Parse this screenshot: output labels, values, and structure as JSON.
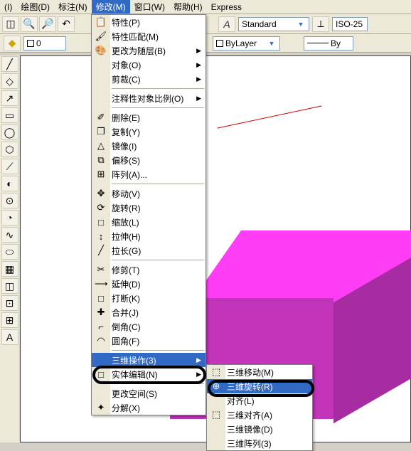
{
  "menubar": {
    "items": [
      "(I)",
      "绘图(D)",
      "标注(N)",
      "修改(M)",
      "窗口(W)",
      "帮助(H)",
      "Express"
    ],
    "activeIndex": 3
  },
  "toolbar1": {
    "standard": "Standard",
    "iso": "ISO-25"
  },
  "toolbar2": {
    "layer": "0",
    "bylayer": "ByLayer",
    "by2": "By"
  },
  "menu": [
    {
      "icon": "📋",
      "label": "特性(P)"
    },
    {
      "icon": "🖌",
      "label": "特性匹配(M)"
    },
    {
      "icon": "🎨",
      "label": "更改为随层(B)",
      "arr": true
    },
    {
      "label": "对象(O)",
      "arr": true
    },
    {
      "label": "剪裁(C)",
      "arr": true
    },
    {
      "sep": true
    },
    {
      "label": "注释性对象比例(O)",
      "arr": true
    },
    {
      "sep": true
    },
    {
      "icon": "✐",
      "label": "删除(E)"
    },
    {
      "icon": "❐",
      "label": "复制(Y)"
    },
    {
      "icon": "△",
      "label": "镜像(I)"
    },
    {
      "icon": "⧉",
      "label": "偏移(S)"
    },
    {
      "icon": "⊞",
      "label": "阵列(A)..."
    },
    {
      "sep": true
    },
    {
      "icon": "✥",
      "label": "移动(V)"
    },
    {
      "icon": "⟳",
      "label": "旋转(R)"
    },
    {
      "icon": "□",
      "label": "缩放(L)"
    },
    {
      "icon": "↕",
      "label": "拉伸(H)"
    },
    {
      "icon": "╱",
      "label": "拉长(G)"
    },
    {
      "sep": true
    },
    {
      "icon": "✂",
      "label": "修剪(T)"
    },
    {
      "icon": "⟶",
      "label": "延伸(D)"
    },
    {
      "icon": "□",
      "label": "打断(K)"
    },
    {
      "icon": "✚",
      "label": "合并(J)"
    },
    {
      "icon": "⌐",
      "label": "倒角(C)"
    },
    {
      "icon": "◠",
      "label": "圆角(F)"
    },
    {
      "sep": true
    },
    {
      "label": "三维操作(3)",
      "arr": true,
      "hl": true
    },
    {
      "icon": "□",
      "label": "实体编辑(N)",
      "arr": true
    },
    {
      "sep": true
    },
    {
      "label": "更改空间(S)"
    },
    {
      "icon": "✦",
      "label": "分解(X)"
    }
  ],
  "submenu": [
    {
      "icon": "⬚",
      "label": "三维移动(M)"
    },
    {
      "icon": "⊕",
      "label": "三维旋转(R)",
      "hl": true
    },
    {
      "label": "对齐(L)"
    },
    {
      "icon": "⬚",
      "label": "三维对齐(A)"
    },
    {
      "label": "三维镜像(D)"
    },
    {
      "label": "三维阵列(3)"
    }
  ]
}
